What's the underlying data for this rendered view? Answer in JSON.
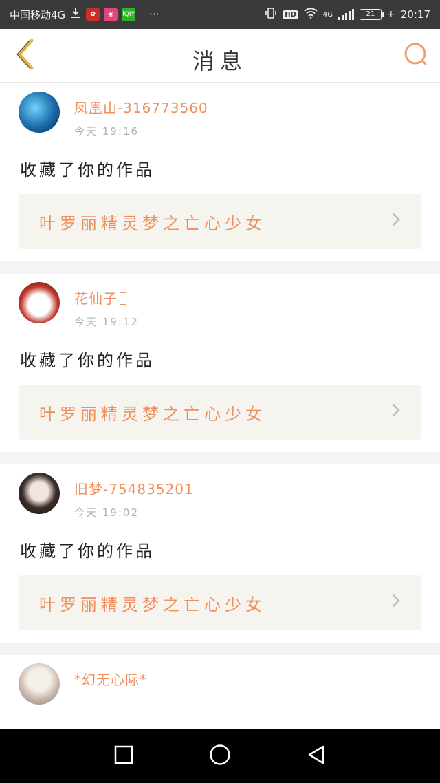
{
  "status_bar": {
    "carrier": "中国移动4G",
    "download_icon": "download-icon",
    "app_icons": [
      "huawei-icon",
      "weibo-icon",
      "iqiyi-icon"
    ],
    "iqiyi_text": "iQIY",
    "more": "···",
    "hd": "HD",
    "network": "4G",
    "battery": "21",
    "time": "20:17"
  },
  "header": {
    "title": "消息",
    "back_icon": "chevron-left-icon",
    "search_icon": "search-icon",
    "accent_color": "#ef8f5e"
  },
  "messages": [
    {
      "user": "凤凰山-316773560",
      "time": "今天 19:16",
      "action": "收藏了你的作品",
      "work": "叶罗丽精灵梦之亡心少女"
    },
    {
      "user": "花仙子",
      "time": "今天 19:12",
      "action": "收藏了你的作品",
      "work": "叶罗丽精灵梦之亡心少女"
    },
    {
      "user": "旧梦-754835201",
      "time": "今天 19:02",
      "action": "收藏了你的作品",
      "work": "叶罗丽精灵梦之亡心少女"
    },
    {
      "user": "*幻无心际*",
      "time": "",
      "action": "",
      "work": ""
    }
  ],
  "nav_bar": {
    "icons": [
      "recent-apps-icon",
      "home-icon",
      "back-icon"
    ]
  }
}
